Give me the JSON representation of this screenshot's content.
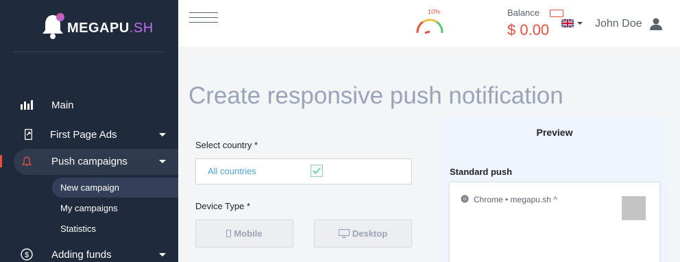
{
  "brand": {
    "name_main": "MEGAPU",
    "name_sh": ".SH"
  },
  "sidebar": {
    "items": [
      {
        "label": "Main",
        "icon": "bar-chart-icon"
      },
      {
        "label": "First Page Ads",
        "icon": "phone-icon"
      },
      {
        "label": "Push campaigns",
        "icon": "bell-icon"
      },
      {
        "label": "Adding funds",
        "icon": "dollar-icon"
      }
    ],
    "sub_items": [
      {
        "label": "New campaign"
      },
      {
        "label": "My campaigns"
      },
      {
        "label": "Statistics"
      }
    ]
  },
  "topbar": {
    "gauge_percent": "10%",
    "balance_label": "Balance",
    "balance_value": "$ 0.00",
    "user_name": "John Doe"
  },
  "main": {
    "title": "Create responsive push notification",
    "country_label": "Select country *",
    "country_value": "All countries",
    "device_label": "Device Type *",
    "device_mobile": "Mobile",
    "device_desktop": "Desktop"
  },
  "preview": {
    "title": "Preview",
    "standard_label": "Standard push",
    "source": "Chrome • megapu.sh ^"
  },
  "colors": {
    "sidebar_bg": "#1f2a3c",
    "accent_red": "#e8503a",
    "accent_blue": "#4aa3df",
    "title_gray": "#9aa4b8"
  }
}
